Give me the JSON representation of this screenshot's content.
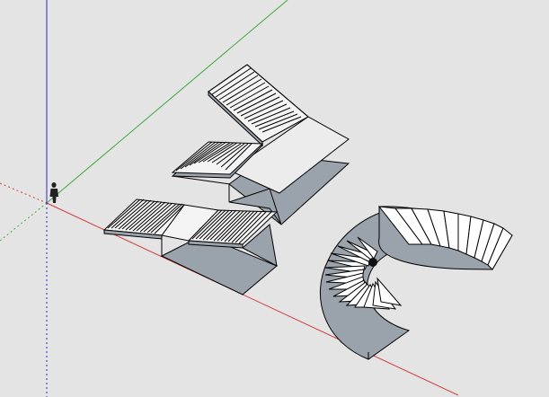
{
  "viewport": {
    "background": "#e4e4e4",
    "axes": {
      "red_axis_color": "#d43b3b",
      "green_axis_color": "#3ea83e",
      "blue_axis_color": "#2a2ad0"
    },
    "materials": {
      "stair_face": "#ffffff",
      "landing_top": "#ececec",
      "underside_shade": "#9aa2ab",
      "edge": "#000000"
    },
    "objects": [
      "scale-figure",
      "u-shaped-stair-with-winder-landing",
      "straight-stair-with-mid-landing",
      "spiral-stair"
    ]
  }
}
